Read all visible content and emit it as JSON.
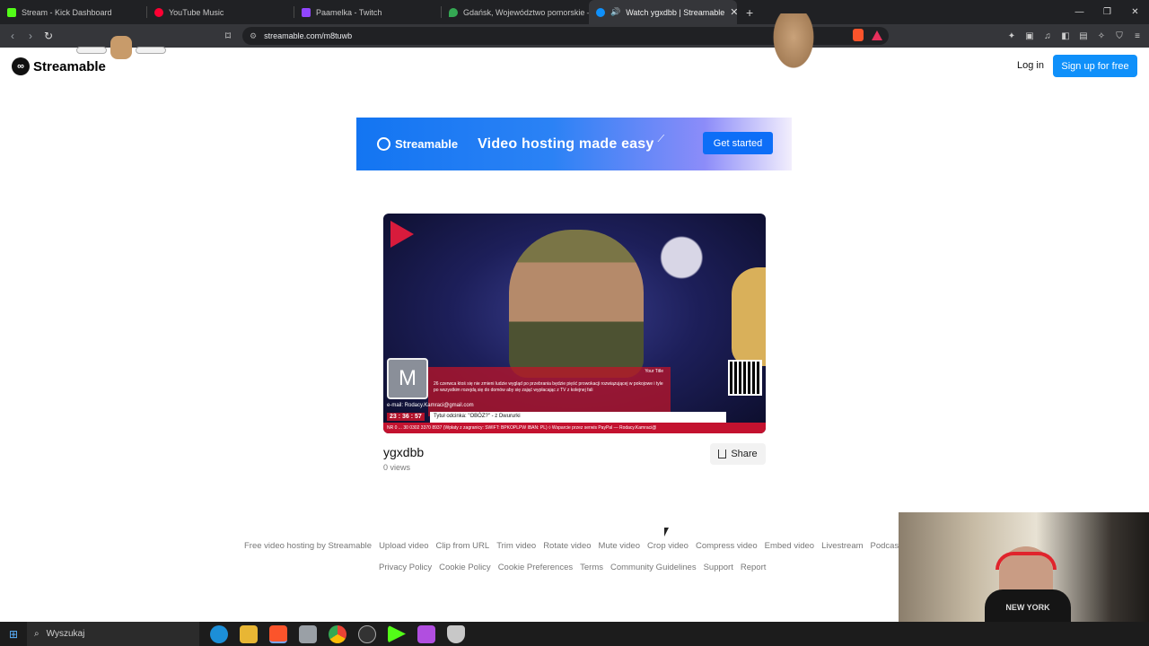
{
  "browser": {
    "tabs": [
      {
        "label": "Stream - Kick Dashboard",
        "color": "#53fc18",
        "active": false
      },
      {
        "label": "YouTube Music",
        "color": "#ff0033",
        "active": false
      },
      {
        "label": "Paamelka - Twitch",
        "color": "#9146ff",
        "active": false
      },
      {
        "label": "Gdańsk, Województwo pomorskie – G",
        "color": "#34a853",
        "active": false
      },
      {
        "label": "Watch ygxdbb | Streamable",
        "color": "#0f90fa",
        "active": true
      }
    ],
    "new_tab": "+",
    "url": "streamable.com/m8tuwb"
  },
  "header": {
    "logo_text": "Streamable",
    "login": "Log in",
    "signup": "Sign up for free"
  },
  "banner": {
    "logo_text": "Streamable",
    "tagline": "Video hosting made easy",
    "cta": "Get started"
  },
  "video": {
    "avatar_letter": "M",
    "overlay_label": "Your Title",
    "overlay_text": "26 czerwca ktoś się nie zmieni ludzie wygląd po przebrania będzie pięść prowokacji rozwiązującej w pokojowe i tyle po wszystkim rozejdą się do domów aby się zająć wypłacając z TV z kolejnej fali",
    "email": "e-mail: Rodacy.Kamraci@gmail.com",
    "time": "23 : 36 : 57",
    "episode_title": "Tytuł odcinka: \"OBÓZ?\" - z Dwururki",
    "ticker": "NR 0 ... 30 0302 3370 8937  (Wpłaty z zagranicy: SWIFT: BPKOPLPW  IBAN: PL)  ◊  Wsparcie przez serwis PayPal — Rodacy.Kamraci@",
    "title": "ygxdbb",
    "views": "0 views",
    "share": "Share"
  },
  "footer": {
    "links_row1": [
      "Free video hosting by Streamable",
      "Upload video",
      "Clip from URL",
      "Trim video",
      "Rotate video",
      "Mute video",
      "Crop video",
      "Compress video",
      "Embed video",
      "Livestream",
      "Podcas"
    ],
    "links_row2": [
      "Privacy Policy",
      "Cookie Policy",
      "Cookie Preferences",
      "Terms",
      "Community Guidelines",
      "Support",
      "Report"
    ]
  },
  "webcam": {
    "shirt_text": "NEW YORK"
  },
  "taskbar": {
    "search_placeholder": "Wyszukaj"
  }
}
